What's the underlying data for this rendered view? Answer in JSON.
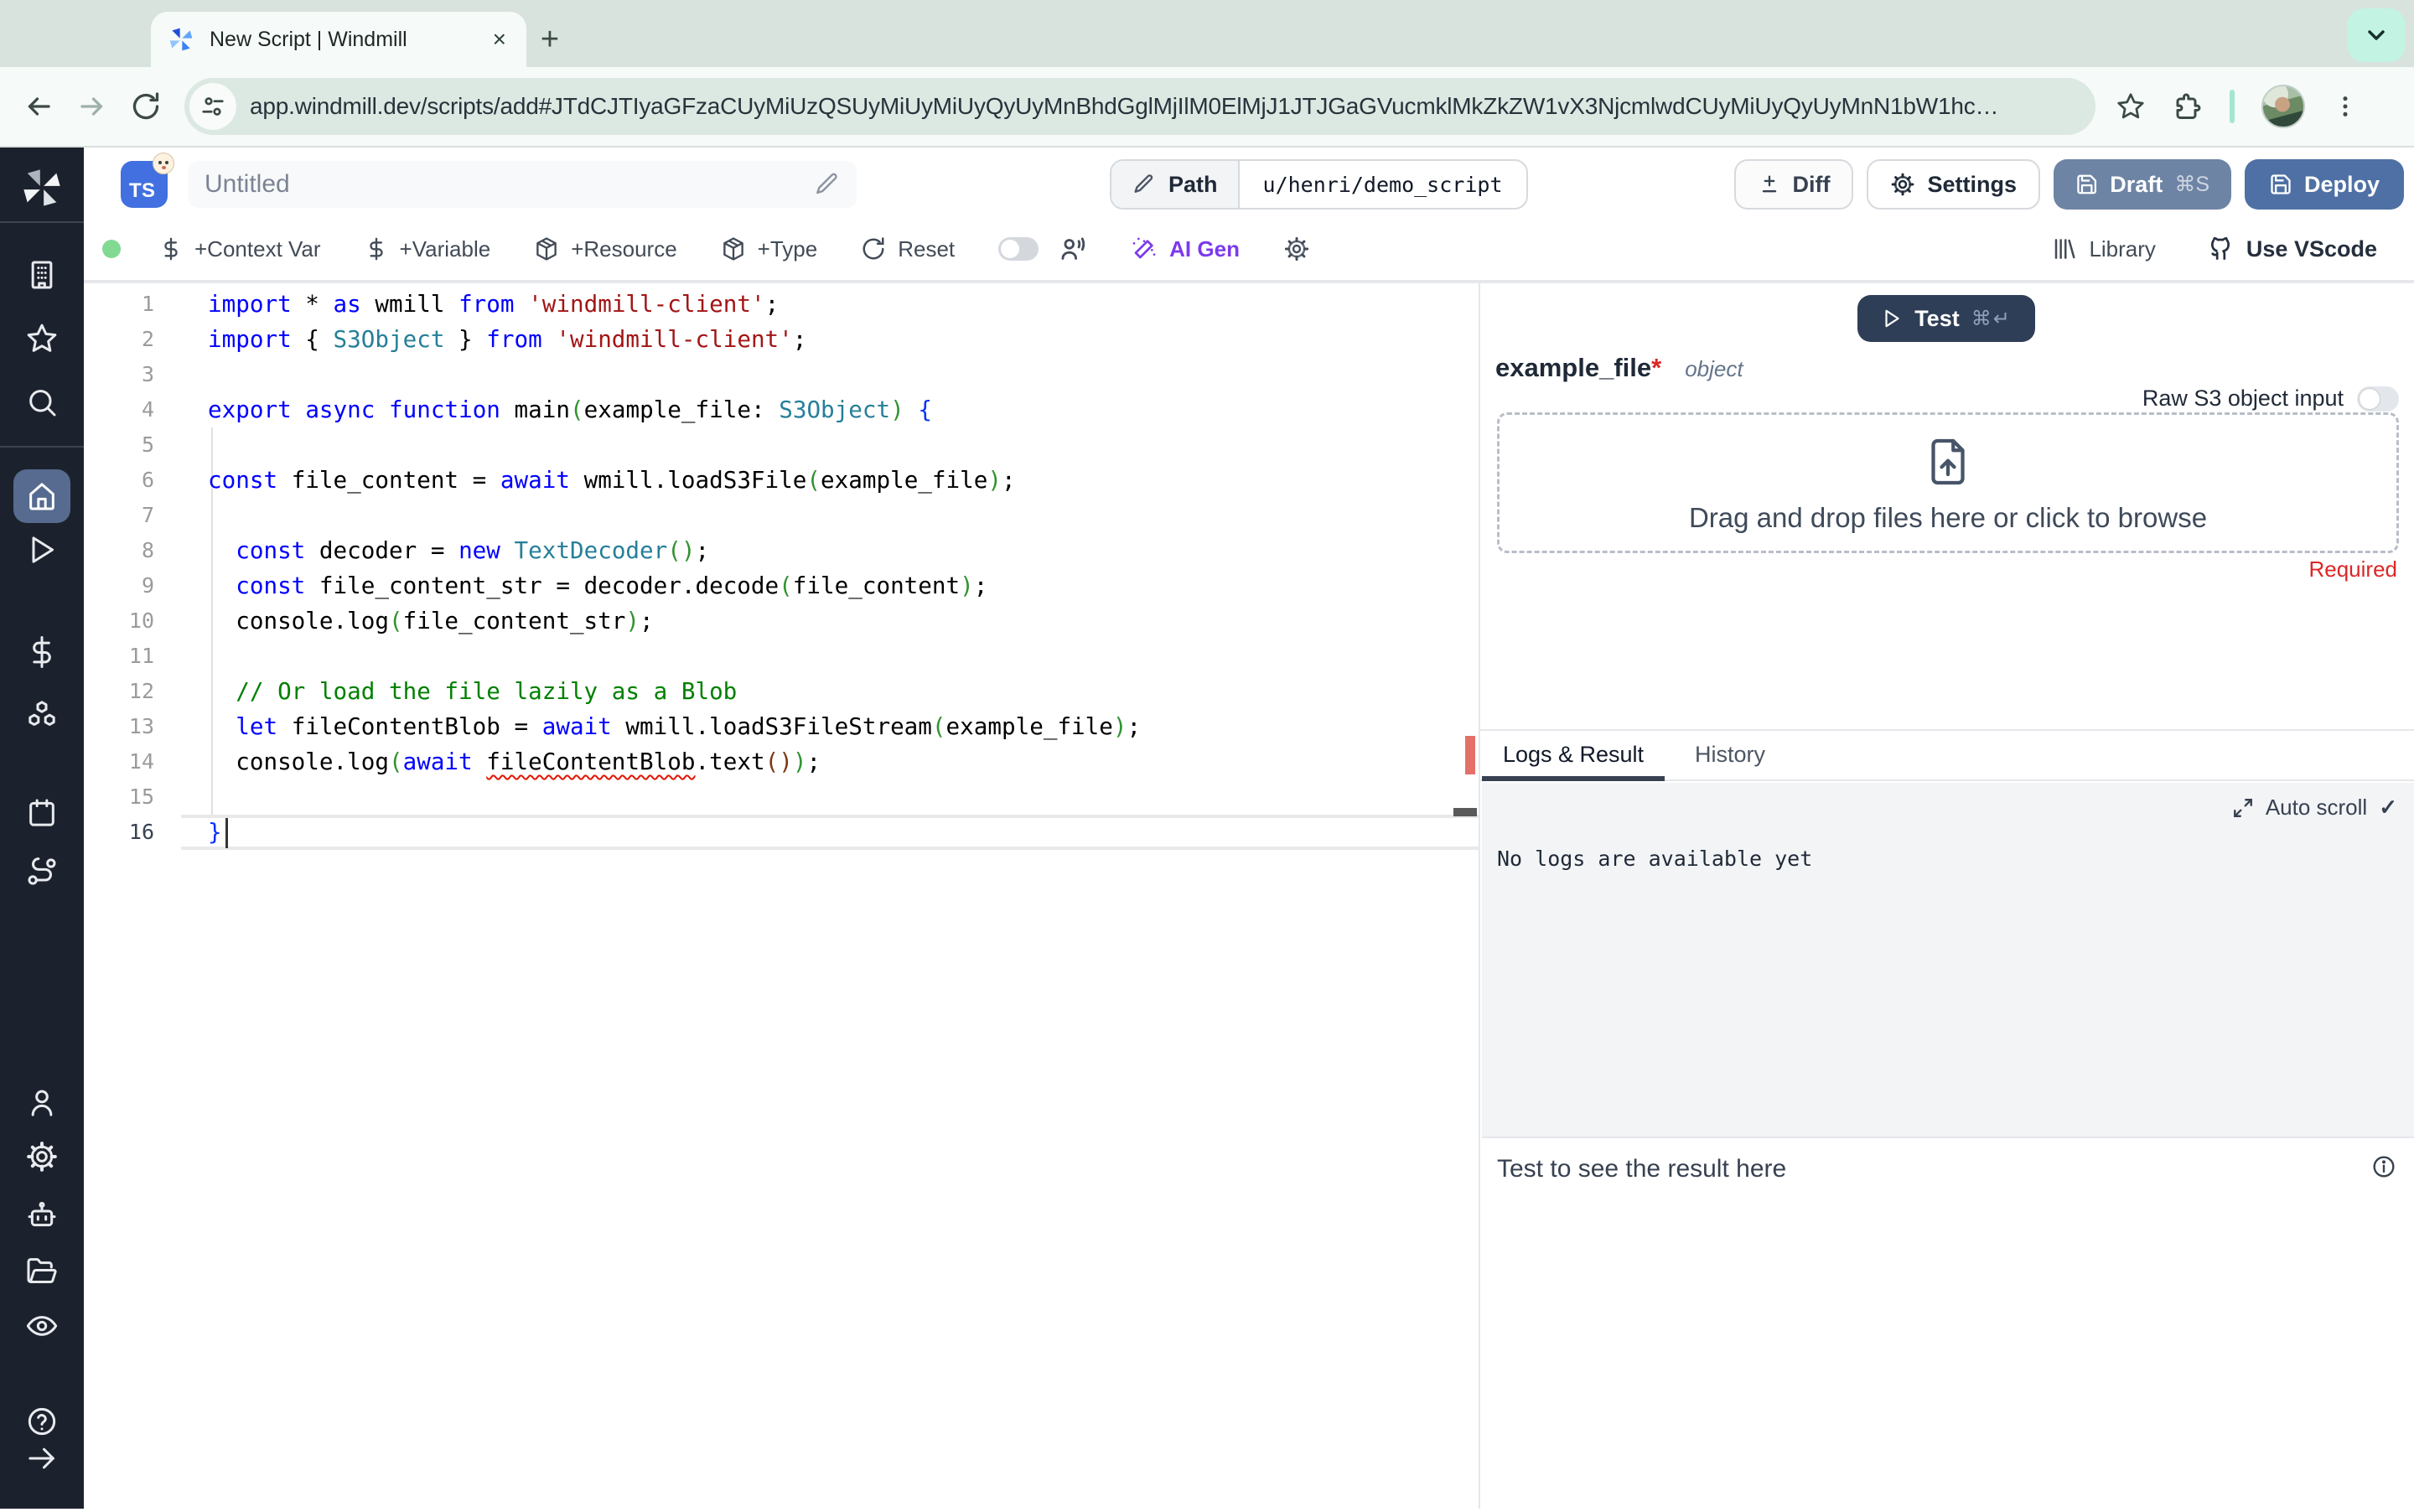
{
  "browser": {
    "tab_title": "New Script | Windmill",
    "close": "×",
    "new_tab": "+",
    "url": "app.windmill.dev/scripts/add#JTdCJTIyaGFzaCUyMiUzQSUyMiUyMiUyQyUyMnBhdGglMjIlM0ElMjJ1JTJGaGVucmklMkZkZW1vX3NjcmlwdCUyMiUyQyUyMnN1bW1hc…"
  },
  "header": {
    "lang_badge": "TS",
    "title": "Untitled",
    "path_label": "Path",
    "path_value": "u/henri/demo_script",
    "diff_label": "Diff",
    "settings_label": "Settings",
    "draft_label": "Draft",
    "draft_kbd": "⌘S",
    "deploy_label": "Deploy"
  },
  "actionbar": {
    "context_var": "+Context Var",
    "variable": "+Variable",
    "resource": "+Resource",
    "type": "+Type",
    "reset": "Reset",
    "ai_gen": "AI Gen",
    "library": "Library",
    "use_vscode": "Use VScode"
  },
  "editor": {
    "lines": [
      {
        "n": 1,
        "tokens": [
          [
            "kw",
            "import"
          ],
          [
            "p",
            " * "
          ],
          [
            "kw",
            "as"
          ],
          [
            "p",
            " wmill "
          ],
          [
            "kw",
            "from"
          ],
          [
            "p",
            " "
          ],
          [
            "str",
            "'windmill-client'"
          ],
          [
            "p",
            ";"
          ]
        ]
      },
      {
        "n": 2,
        "tokens": [
          [
            "kw",
            "import"
          ],
          [
            "p",
            " { "
          ],
          [
            "type",
            "S3Object"
          ],
          [
            "p",
            " } "
          ],
          [
            "kw",
            "from"
          ],
          [
            "p",
            " "
          ],
          [
            "str",
            "'windmill-client'"
          ],
          [
            "p",
            ";"
          ]
        ]
      },
      {
        "n": 3,
        "tokens": []
      },
      {
        "n": 4,
        "tokens": [
          [
            "kw",
            "export"
          ],
          [
            "p",
            " "
          ],
          [
            "kw",
            "async"
          ],
          [
            "p",
            " "
          ],
          [
            "kw",
            "function"
          ],
          [
            "p",
            " main"
          ],
          [
            "b2",
            "("
          ],
          [
            "p",
            "example_file: "
          ],
          [
            "type",
            "S3Object"
          ],
          [
            "b2",
            ")"
          ],
          [
            "p",
            " "
          ],
          [
            "b1",
            "{"
          ]
        ]
      },
      {
        "n": 5,
        "tokens": []
      },
      {
        "n": 6,
        "tokens": [
          [
            "kw",
            "const"
          ],
          [
            "p",
            " file_content = "
          ],
          [
            "kw",
            "await"
          ],
          [
            "p",
            " wmill.loadS3File"
          ],
          [
            "b2",
            "("
          ],
          [
            "p",
            "example_file"
          ],
          [
            "b2",
            ")"
          ],
          [
            "p",
            ";"
          ]
        ]
      },
      {
        "n": 7,
        "tokens": []
      },
      {
        "n": 8,
        "tokens": [
          [
            "p",
            "  "
          ],
          [
            "kw",
            "const"
          ],
          [
            "p",
            " decoder = "
          ],
          [
            "kw",
            "new"
          ],
          [
            "p",
            " "
          ],
          [
            "type",
            "TextDecoder"
          ],
          [
            "b2",
            "()"
          ],
          [
            "p",
            ";"
          ]
        ]
      },
      {
        "n": 9,
        "tokens": [
          [
            "p",
            "  "
          ],
          [
            "kw",
            "const"
          ],
          [
            "p",
            " file_content_str = decoder.decode"
          ],
          [
            "b2",
            "("
          ],
          [
            "p",
            "file_content"
          ],
          [
            "b2",
            ")"
          ],
          [
            "p",
            ";"
          ]
        ]
      },
      {
        "n": 10,
        "tokens": [
          [
            "p",
            "  console.log"
          ],
          [
            "b2",
            "("
          ],
          [
            "p",
            "file_content_str"
          ],
          [
            "b2",
            ")"
          ],
          [
            "p",
            ";"
          ]
        ]
      },
      {
        "n": 11,
        "tokens": []
      },
      {
        "n": 12,
        "tokens": [
          [
            "p",
            "  "
          ],
          [
            "cmt",
            "// Or load the file lazily as a Blob"
          ]
        ]
      },
      {
        "n": 13,
        "tokens": [
          [
            "p",
            "  "
          ],
          [
            "kw",
            "let"
          ],
          [
            "p",
            " fileContentBlob = "
          ],
          [
            "kw",
            "await"
          ],
          [
            "p",
            " wmill.loadS3FileStream"
          ],
          [
            "b2",
            "("
          ],
          [
            "p",
            "example_file"
          ],
          [
            "b2",
            ")"
          ],
          [
            "p",
            ";"
          ]
        ]
      },
      {
        "n": 14,
        "tokens": [
          [
            "p",
            "  console.log"
          ],
          [
            "b2",
            "("
          ],
          [
            "kw",
            "await"
          ],
          [
            "p",
            " "
          ],
          [
            "sq",
            "fileContentBlob"
          ],
          [
            "p",
            ".text"
          ],
          [
            "b3",
            "()"
          ],
          [
            "b2",
            ")"
          ],
          [
            "p",
            ";"
          ]
        ]
      },
      {
        "n": 15,
        "tokens": []
      },
      {
        "n": 16,
        "tokens": [
          [
            "b1",
            "}"
          ]
        ]
      }
    ]
  },
  "sidebar": {
    "groups": [
      [
        "building",
        "star",
        "search"
      ],
      [
        "home",
        "play",
        "dollar",
        "boxes",
        "calendar",
        "route"
      ],
      [
        "person",
        "gear",
        "robot",
        "folder-open",
        "eye"
      ],
      [
        "help",
        "arrow-right"
      ]
    ],
    "active": "home"
  },
  "right_panel": {
    "test_label": "Test",
    "test_kbd": "⌘↵",
    "arg_name": "example_file",
    "arg_required_mark": "*",
    "arg_type": "object",
    "raw_s3_label": "Raw S3 object input",
    "dropzone_text": "Drag and drop files here or click to browse",
    "required_label": "Required",
    "tab_logs": "Logs & Result",
    "tab_history": "History",
    "auto_scroll": "Auto scroll",
    "auto_scroll_check": "✓",
    "no_logs": "No logs are available yet",
    "result_placeholder": "Test to see the result here"
  }
}
